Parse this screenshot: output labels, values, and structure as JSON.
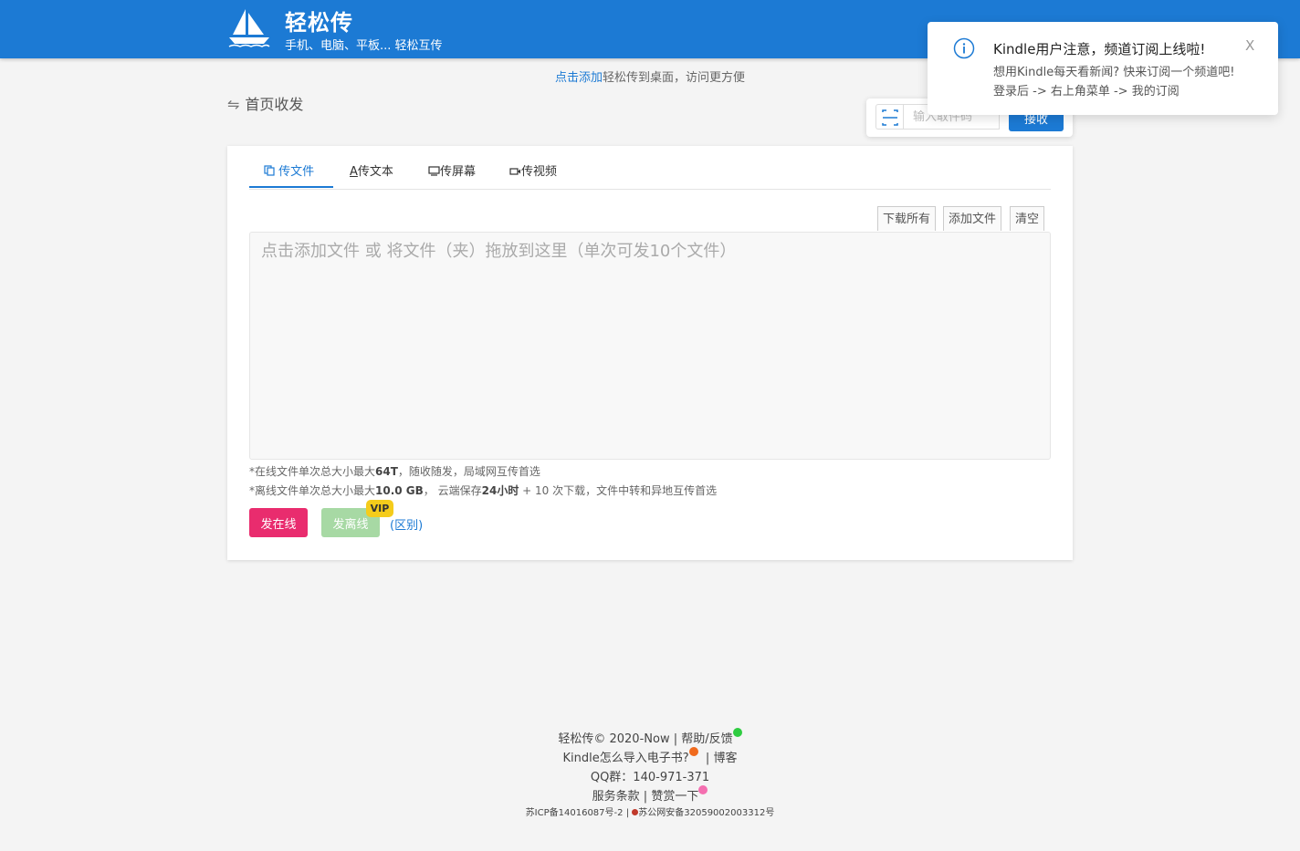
{
  "header": {
    "title": "轻松传",
    "subtitle": "手机、电脑、平板... 轻松互传",
    "brand_color": "#1c7ad4"
  },
  "notice": {
    "link": "点击添加",
    "text": "轻松传到桌面，访问更方便"
  },
  "page_title": "首页收发",
  "receive": {
    "placeholder": "输入取件码",
    "button": "接收"
  },
  "tabs": [
    {
      "label": "传文件",
      "icon": "files-icon",
      "active": true
    },
    {
      "label": "传文本",
      "icon": "text-icon"
    },
    {
      "label": "传屏幕",
      "icon": "screen-icon"
    },
    {
      "label": "传视频",
      "icon": "video-icon"
    }
  ],
  "toolbar": {
    "download_all": "下载所有",
    "add_file": "添加文件",
    "clear": "清空"
  },
  "dropzone": {
    "placeholder": "点击添加文件 或 将文件（夹）拖放到这里（单次可发10个文件）"
  },
  "notes": {
    "online_prefix": "*在线文件单次总大小最大",
    "online_size": "64T",
    "online_suffix": "，随收随发，局域网互传首选",
    "offline_prefix": "*离线文件单次总大小最大",
    "offline_size": "10.0 GB",
    "offline_mid": "， 云端保存",
    "offline_hours": "24小时",
    "offline_suffix": " + 10 次下载，文件中转和异地互传首选"
  },
  "actions": {
    "send_online": "发在线",
    "send_offline": "发离线",
    "vip": "VIP",
    "difference": "(区别)",
    "online_color": "#e92c6e",
    "offline_color": "#a7d9a4"
  },
  "footer": {
    "copyright": "轻松传© 2020-Now",
    "help": "帮助/反馈",
    "kindle_howto": "Kindle怎么导入电子书?",
    "blog": "博客",
    "qq_group": "QQ群：140-971-371",
    "terms": "服务条款",
    "donate": "赞赏一下",
    "icp": "苏ICP备14016087号-2",
    "police": "苏公网安备32059002003312号"
  },
  "toast": {
    "title": "Kindle用户注意，频道订阅上线啦!",
    "body": "想用Kindle每天看新闻? 快来订阅一个频道吧! 登录后 -> 右上角菜单 -> 我的订阅",
    "close": "X",
    "icon": "info-icon"
  }
}
